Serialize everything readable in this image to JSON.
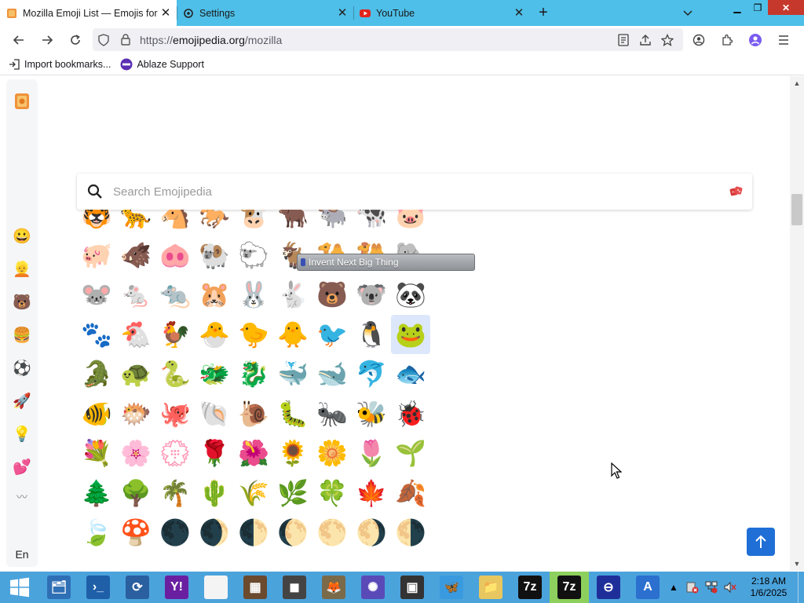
{
  "browser": {
    "tabs": [
      {
        "title": "Mozilla Emoji List — Emojis for Mozilla",
        "active": true,
        "favicon": "emojipedia-icon"
      },
      {
        "title": "Settings",
        "active": false,
        "favicon": "gear-icon"
      },
      {
        "title": "YouTube",
        "active": false,
        "favicon": "youtube-icon"
      }
    ],
    "new_tab_label": "+",
    "url": {
      "prefix": "https://",
      "host": "emojipedia.org",
      "path": "/mozilla"
    },
    "bookmarks": [
      {
        "label": "Import bookmarks...",
        "icon": "import-icon"
      },
      {
        "label": "Ablaze Support",
        "icon": "ablaze-icon"
      }
    ]
  },
  "page": {
    "search_placeholder": "Search Emojipedia",
    "sidebar": {
      "categories": [
        {
          "name": "smileys",
          "glyph": "😀"
        },
        {
          "name": "people",
          "glyph": "👱"
        },
        {
          "name": "animals",
          "glyph": "🐻"
        },
        {
          "name": "food",
          "glyph": "🍔"
        },
        {
          "name": "activities",
          "glyph": "⚽"
        },
        {
          "name": "travel",
          "glyph": "🚀"
        },
        {
          "name": "objects",
          "glyph": "💡"
        },
        {
          "name": "symbols",
          "glyph": "💕"
        },
        {
          "name": "flags",
          "glyph": "〰"
        }
      ],
      "language": "En"
    },
    "emoji_rows": [
      [
        "🐯",
        "🐆",
        "🐴",
        "🐎",
        "🐮",
        "🐂",
        "🐃",
        "🐄",
        "🐷"
      ],
      [
        "🐖",
        "🐗",
        "🐽",
        "🐏",
        "🐑",
        "🐐",
        "🐪",
        "🐫",
        "🐘"
      ],
      [
        "🐭",
        "🐁",
        "🐀",
        "🐹",
        "🐰",
        "🐇",
        "🐻",
        "🐨",
        "🐼"
      ],
      [
        "🐾",
        "🐔",
        "🐓",
        "🐣",
        "🐤",
        "🐥",
        "🐦",
        "🐧",
        "🐸"
      ],
      [
        "🐊",
        "🐢",
        "🐍",
        "🐲",
        "🐉",
        "🐳",
        "🐋",
        "🐬",
        "🐟"
      ],
      [
        "🐠",
        "🐡",
        "🐙",
        "🐚",
        "🐌",
        "🐛",
        "🐜",
        "🐝",
        "🐞"
      ],
      [
        "💐",
        "🌸",
        "💮",
        "🌹",
        "🌺",
        "🌻",
        "🌼",
        "🌷",
        "🌱"
      ],
      [
        "🌲",
        "🌳",
        "🌴",
        "🌵",
        "🌾",
        "🌿",
        "🍀",
        "🍁",
        "🍂"
      ],
      [
        "🍃",
        "🍄",
        "🌑",
        "🌒",
        "🌓",
        "🌔",
        "🌕",
        "🌖",
        "🌗"
      ]
    ],
    "selected_emoji": "🐸",
    "overlay_text": "Invent Next Big Thing"
  },
  "taskbar": {
    "apps": [
      {
        "name": "file-manager-app",
        "color": "#2f6fb5",
        "glyph": "🗂"
      },
      {
        "name": "powershell-app",
        "color": "#1e5fa8",
        "glyph": "›_"
      },
      {
        "name": "sync-app",
        "color": "#2a5fa0",
        "glyph": "⟳"
      },
      {
        "name": "yahoo-messenger-app",
        "color": "#6a1fa0",
        "glyph": "Y!"
      },
      {
        "name": "blank-document-app",
        "color": "#f4f4f4",
        "glyph": ""
      },
      {
        "name": "minecraft-app",
        "color": "#6b4a2e",
        "glyph": "▦"
      },
      {
        "name": "screenshot-app",
        "color": "#444",
        "glyph": "◼"
      },
      {
        "name": "gimp-app",
        "color": "#7a6a4a",
        "glyph": "🦊"
      },
      {
        "name": "settings-app",
        "color": "#5a4ab8",
        "glyph": "✺"
      },
      {
        "name": "system-monitor-app",
        "color": "#333",
        "glyph": "▣"
      },
      {
        "name": "butterfly-app",
        "color": "#3a9adf",
        "glyph": "🦋"
      },
      {
        "name": "explorer-app",
        "color": "#e8c760",
        "glyph": "📁"
      },
      {
        "name": "7zip-app",
        "color": "#111",
        "glyph": "7z"
      },
      {
        "name": "7zip-app-active",
        "color": "#111",
        "glyph": "7z"
      },
      {
        "name": "ablaze-app",
        "color": "#1f2f9a",
        "glyph": "⊖"
      },
      {
        "name": "arc-app",
        "color": "#2b6fcf",
        "glyph": "A"
      }
    ],
    "clock": {
      "time": "2:18 AM",
      "date": "1/6/2025"
    }
  }
}
